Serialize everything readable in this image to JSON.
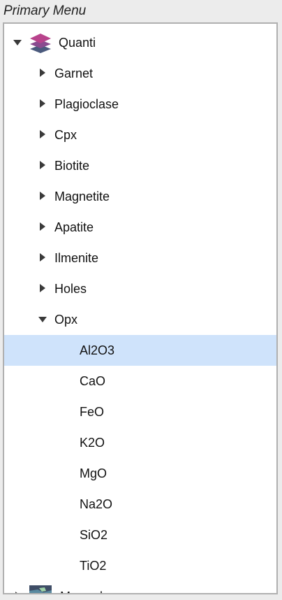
{
  "panel": {
    "title": "Primary Menu"
  },
  "root": {
    "label": "Quanti",
    "icon": "layers-icon",
    "expanded": true
  },
  "phases": [
    {
      "label": "Garnet"
    },
    {
      "label": "Plagioclase"
    },
    {
      "label": "Cpx"
    },
    {
      "label": "Biotite"
    },
    {
      "label": "Magnetite"
    },
    {
      "label": "Apatite"
    },
    {
      "label": "Ilmenite"
    },
    {
      "label": "Holes"
    },
    {
      "label": "Opx"
    }
  ],
  "opx_children": [
    {
      "label": "Al2O3",
      "selected": true
    },
    {
      "label": "CaO"
    },
    {
      "label": "FeO"
    },
    {
      "label": "K2O"
    },
    {
      "label": "MgO"
    },
    {
      "label": "Na2O"
    },
    {
      "label": "SiO2"
    },
    {
      "label": "TiO2"
    }
  ],
  "next_root": {
    "label": "Merged",
    "icon": "map-icon"
  },
  "colors": {
    "selection": "#cfe3fb",
    "layer_top": "#b8438c",
    "layer_mid": "#8a4b8f",
    "layer_bottom": "#4b5a7d"
  }
}
